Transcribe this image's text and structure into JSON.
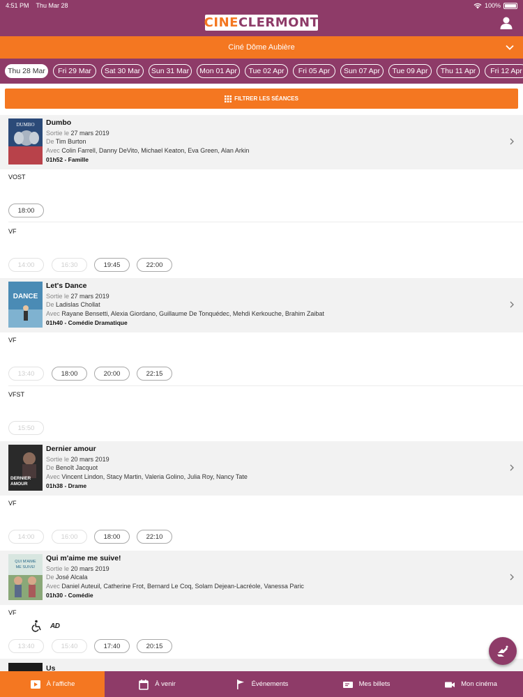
{
  "status_bar": {
    "time": "4:51 PM",
    "date": "Thu Mar 28",
    "battery": "100%"
  },
  "header": {
    "logo_part1": "CINE",
    "logo_part2": "CLERMONT"
  },
  "cinema_selector": {
    "name": "Ciné Dôme Aubière"
  },
  "dates": [
    "Thu 28 Mar",
    "Fri 29 Mar",
    "Sat 30 Mar",
    "Sun 31 Mar",
    "Mon 01 Apr",
    "Tue 02 Apr",
    "Fri 05 Apr",
    "Sun 07 Apr",
    "Tue 09 Apr",
    "Thu 11 Apr",
    "Fri 12 Apr"
  ],
  "filter": {
    "label": "FILTRER LES SÉANCES"
  },
  "labels": {
    "release": "Sortie le",
    "director": "De",
    "cast": "Avec"
  },
  "movies": [
    {
      "title": "Dumbo",
      "release": "27 mars 2019",
      "director": "Tim Burton",
      "cast": "Colin Farrell,  Danny DeVito,  Michael Keaton,  Eva Green,  Alan Arkin",
      "duration": "01h52 - Famille",
      "groups": [
        {
          "version": "VOST",
          "times": [
            "18:00"
          ]
        },
        {
          "version": "VF",
          "times": [
            "14:00",
            "16:30",
            "19:45",
            "22:00"
          ]
        }
      ]
    },
    {
      "title": "Let's Dance",
      "release": "27 mars 2019",
      "director": "Ladislas Chollat",
      "cast": "Rayane Bensetti,  Alexia Giordano,  Guillaume De Tonquédec,  Mehdi Kerkouche,  Brahim Zaibat",
      "duration": "01h40 - Comédie Dramatique",
      "groups": [
        {
          "version": "VF",
          "times": [
            "13:40",
            "18:00",
            "20:00",
            "22:15"
          ]
        },
        {
          "version": "VFST",
          "times": [
            "15:50"
          ]
        }
      ]
    },
    {
      "title": "Dernier amour",
      "release": "20 mars 2019",
      "director": "Benoît Jacquot",
      "cast": "Vincent Lindon,  Stacy Martin,  Valeria Golino,  Julia Roy,  Nancy Tate",
      "duration": "01h38 - Drame",
      "groups": [
        {
          "version": "VF",
          "times": [
            "14:00",
            "16:00",
            "18:00",
            "22:10"
          ]
        }
      ]
    },
    {
      "title": "Qui m'aime me suive!",
      "release": "20 mars 2019",
      "director": "José Alcala",
      "cast": "Daniel Auteuil,  Catherine Frot,  Bernard Le Coq,  Solam Dejean-Lacréole,  Vanessa Paric",
      "duration": "01h30 - Comédie",
      "groups": [
        {
          "version": "VF",
          "times": [
            "13:40",
            "15:40",
            "17:40",
            "20:15"
          ]
        }
      ]
    },
    {
      "title": "Us"
    }
  ],
  "posters": {
    "dumbo": "DUMBO",
    "lets_dance": "DANCE",
    "dernier_amour_1": "DERNIER",
    "dernier_amour_2": "AMOUR",
    "qui_maime_1": "QUI M'AIME",
    "qui_maime_2": "ME SUIVE!"
  },
  "accessibility": {
    "audio_description": "AD"
  },
  "bottom_nav": [
    {
      "label": "À l'affiche",
      "icon": "film-icon"
    },
    {
      "label": "À venir",
      "icon": "calendar-icon"
    },
    {
      "label": "Événements",
      "icon": "flag-icon"
    },
    {
      "label": "Mes billets",
      "icon": "ticket-icon"
    },
    {
      "label": "Mon cinéma",
      "icon": "camera-icon"
    }
  ],
  "colors": {
    "primary": "#8e3b68",
    "accent": "#f47721"
  }
}
